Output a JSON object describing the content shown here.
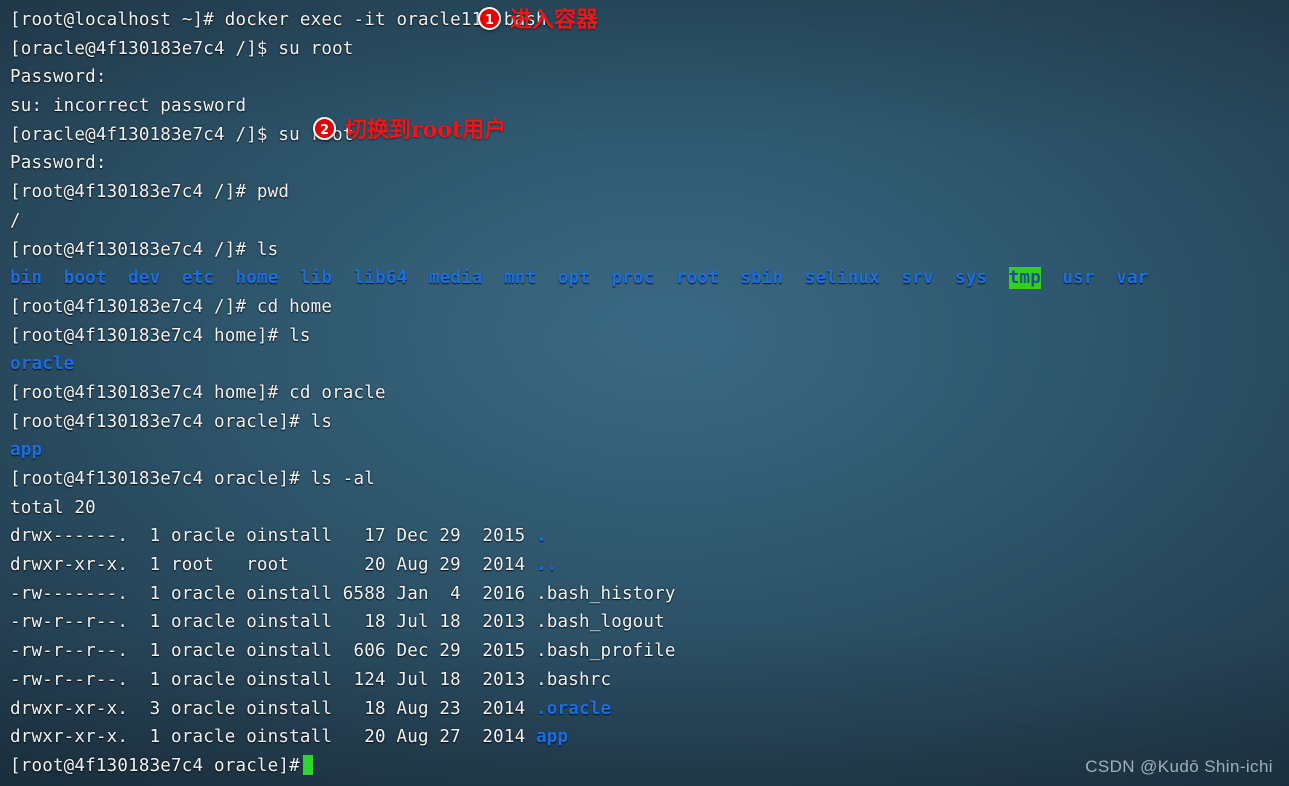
{
  "terminal": {
    "prompt_host_local": "[root@localhost ~]#",
    "prompt_oracle_root": "[oracle@4f130183e7c4 /]$",
    "prompt_root_slash": "[root@4f130183e7c4 /]#",
    "prompt_root_home": "[root@4f130183e7c4 home]#",
    "prompt_root_oracle": "[root@4f130183e7c4 oracle]#",
    "lines": [
      {
        "id": "l1",
        "text": "[root@localhost ~]# docker exec -it oracle11g bash"
      },
      {
        "id": "l2",
        "text": "[oracle@4f130183e7c4 /]$ su root"
      },
      {
        "id": "l3",
        "text": "Password:"
      },
      {
        "id": "l4",
        "text": "su: incorrect password"
      },
      {
        "id": "l5",
        "text": "[oracle@4f130183e7c4 /]$ su root"
      },
      {
        "id": "l6",
        "text": "Password:"
      },
      {
        "id": "l7",
        "text": "[root@4f130183e7c4 /]# pwd"
      },
      {
        "id": "l8",
        "text": "/"
      },
      {
        "id": "l9",
        "text": "[root@4f130183e7c4 /]# ls"
      },
      {
        "id": "l11",
        "text": "[root@4f130183e7c4 /]# cd home"
      },
      {
        "id": "l12",
        "text": "[root@4f130183e7c4 home]# ls"
      },
      {
        "id": "l13",
        "text": "oracle"
      },
      {
        "id": "l14",
        "text": "[root@4f130183e7c4 home]# cd oracle"
      },
      {
        "id": "l15",
        "text": "[root@4f130183e7c4 oracle]# ls"
      },
      {
        "id": "l16",
        "text": "app"
      },
      {
        "id": "l17",
        "text": "[root@4f130183e7c4 oracle]# ls -al"
      },
      {
        "id": "l18",
        "text": "total 20"
      },
      {
        "id": "l26",
        "text": "[root@4f130183e7c4 oracle]#"
      }
    ],
    "ls_root_entries": [
      {
        "name": "bin",
        "style": "dir"
      },
      {
        "name": "boot",
        "style": "dir"
      },
      {
        "name": "dev",
        "style": "dir"
      },
      {
        "name": "etc",
        "style": "dir"
      },
      {
        "name": "home",
        "style": "dir"
      },
      {
        "name": "lib",
        "style": "dir"
      },
      {
        "name": "lib64",
        "style": "dir"
      },
      {
        "name": "media",
        "style": "dir"
      },
      {
        "name": "mnt",
        "style": "dir"
      },
      {
        "name": "opt",
        "style": "dir"
      },
      {
        "name": "proc",
        "style": "dir"
      },
      {
        "name": "root",
        "style": "dir"
      },
      {
        "name": "sbin",
        "style": "dir"
      },
      {
        "name": "selinux",
        "style": "dir"
      },
      {
        "name": "srv",
        "style": "dir"
      },
      {
        "name": "sys",
        "style": "dir"
      },
      {
        "name": "tmp",
        "style": "sticky"
      },
      {
        "name": "usr",
        "style": "dir"
      },
      {
        "name": "var",
        "style": "dir"
      }
    ],
    "ls_al_rows": [
      {
        "perms": "drwx------.",
        "links": "1",
        "owner": "oracle",
        "group": "oinstall",
        "size": "17",
        "month": "Dec",
        "day": "29",
        "year": "2015",
        "name": ".",
        "style": "dir"
      },
      {
        "perms": "drwxr-xr-x.",
        "links": "1",
        "owner": "root",
        "group": "root",
        "size": "20",
        "month": "Aug",
        "day": "29",
        "year": "2014",
        "name": "..",
        "style": "dir"
      },
      {
        "perms": "-rw-------.",
        "links": "1",
        "owner": "oracle",
        "group": "oinstall",
        "size": "6588",
        "month": "Jan",
        "day": "4",
        "year": "2016",
        "name": ".bash_history",
        "style": "file"
      },
      {
        "perms": "-rw-r--r--.",
        "links": "1",
        "owner": "oracle",
        "group": "oinstall",
        "size": "18",
        "month": "Jul",
        "day": "18",
        "year": "2013",
        "name": ".bash_logout",
        "style": "file"
      },
      {
        "perms": "-rw-r--r--.",
        "links": "1",
        "owner": "oracle",
        "group": "oinstall",
        "size": "606",
        "month": "Dec",
        "day": "29",
        "year": "2015",
        "name": ".bash_profile",
        "style": "file"
      },
      {
        "perms": "-rw-r--r--.",
        "links": "1",
        "owner": "oracle",
        "group": "oinstall",
        "size": "124",
        "month": "Jul",
        "day": "18",
        "year": "2013",
        "name": ".bashrc",
        "style": "file"
      },
      {
        "perms": "drwxr-xr-x.",
        "links": "3",
        "owner": "oracle",
        "group": "oinstall",
        "size": "18",
        "month": "Aug",
        "day": "23",
        "year": "2014",
        "name": ".oracle",
        "style": "dir"
      },
      {
        "perms": "drwxr-xr-x.",
        "links": "1",
        "owner": "oracle",
        "group": "oinstall",
        "size": "20",
        "month": "Aug",
        "day": "27",
        "year": "2014",
        "name": "app",
        "style": "dir"
      }
    ]
  },
  "annotations": [
    {
      "number": "1",
      "text": "进入容器"
    },
    {
      "number": "2",
      "text": "切换到root用户"
    }
  ],
  "watermark": "CSDN @Kudō Shin-ichi",
  "colors": {
    "text": "#f2f4f6",
    "directory_blue": "#1c6ee0",
    "sticky_bg": "#33d017",
    "annotation_red": "#f41414",
    "cursor_green": "#2fd42f"
  }
}
